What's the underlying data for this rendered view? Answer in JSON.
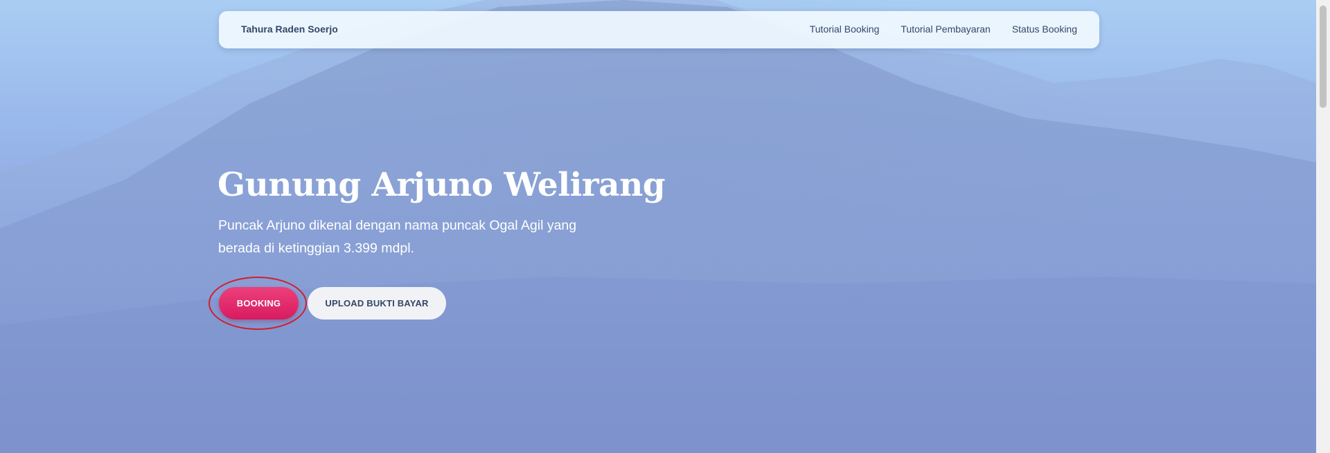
{
  "navbar": {
    "brand": "Tahura Raden Soerjo",
    "links": [
      {
        "label": "Tutorial Booking"
      },
      {
        "label": "Tutorial Pembayaran"
      },
      {
        "label": "Status Booking"
      }
    ]
  },
  "hero": {
    "title": "Gunung Arjuno Welirang",
    "subtitle": "Puncak Arjuno dikenal dengan nama puncak Ogal Agil yang berada di ketinggian 3.399 mdpl.",
    "booking_button": "BOOKING",
    "upload_button": "UPLOAD BUKTI BAYAR"
  },
  "colors": {
    "primary": "#e91e63",
    "text_dark": "#344767",
    "annotation": "#d21d2b"
  }
}
